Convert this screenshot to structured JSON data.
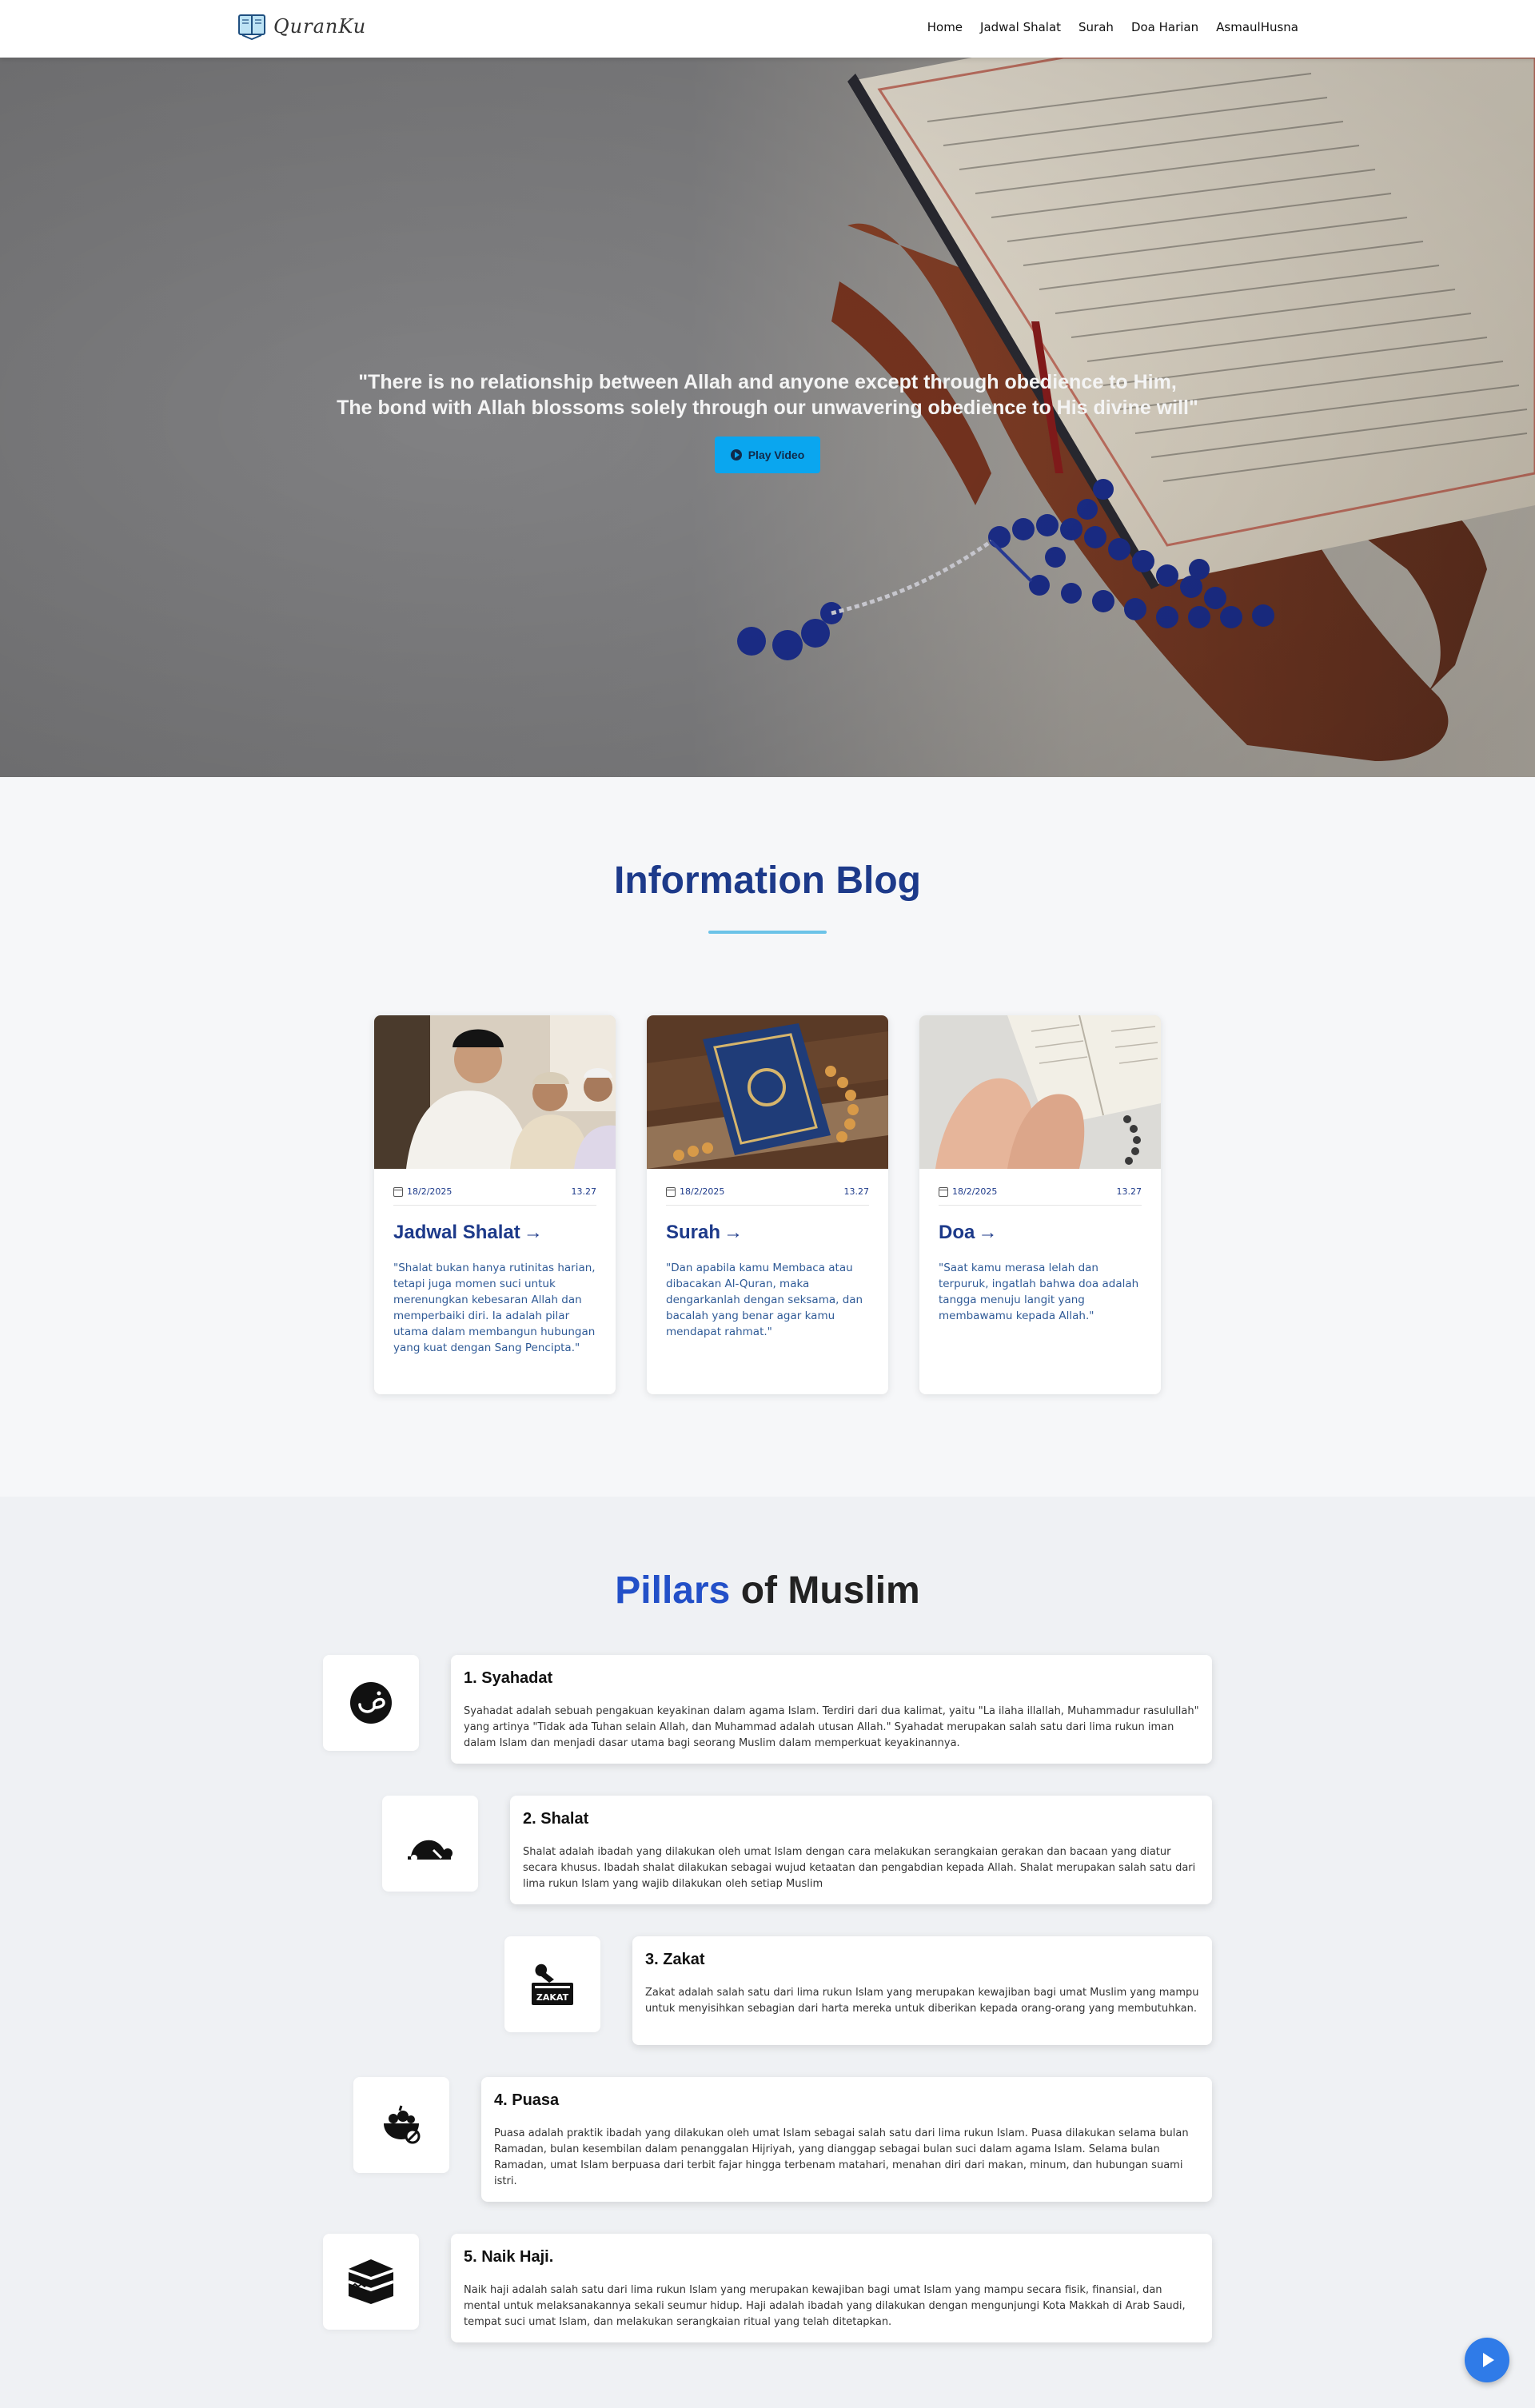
{
  "brand": {
    "name": "QuranKu"
  },
  "nav": {
    "items": [
      "Home",
      "Jadwal Shalat",
      "Surah",
      "Doa Harian",
      "AsmaulHusna"
    ]
  },
  "hero": {
    "quote_line1": "\"There is no relationship between Allah and anyone except through obedience to Him,",
    "quote_line2": "The bond with Allah blossoms solely through our unwavering obedience to His divine will\"",
    "play_label": "Play Video"
  },
  "blog": {
    "title": "Information Blog",
    "cards": [
      {
        "date": "18/2/2025",
        "time": "13.27",
        "title": "Jadwal Shalat",
        "arrow": "→",
        "text": "\"Shalat bukan hanya rutinitas harian, tetapi juga momen suci untuk merenungkan kebesaran Allah dan memperbaiki diri. Ia adalah pilar utama dalam membangun hubungan yang kuat dengan Sang Pencipta.\""
      },
      {
        "date": "18/2/2025",
        "time": "13.27",
        "title": "Surah",
        "arrow": "→",
        "text": "\"Dan apabila kamu Membaca atau dibacakan Al-Quran, maka dengarkanlah dengan seksama, dan bacalah yang benar agar kamu mendapat rahmat.\""
      },
      {
        "date": "18/2/2025",
        "time": "13.27",
        "title": "Doa",
        "arrow": "→",
        "text": "\"Saat kamu merasa lelah dan terpuruk, ingatlah bahwa doa adalah tangga menuju langit yang membawamu kepada Allah.\""
      }
    ]
  },
  "pillars": {
    "title_accent": "Pillars",
    "title_rest": " of Muslim",
    "items": [
      {
        "title": "1. Syahadat",
        "icon": "arabic-letter-icon",
        "text": "Syahadat adalah sebuah pengakuan keyakinan dalam agama Islam. Terdiri dari dua kalimat, yaitu \"La ilaha illallah, Muhammadur rasulullah\" yang artinya \"Tidak ada Tuhan selain Allah, dan Muhammad adalah utusan Allah.\" Syahadat merupakan salah satu dari lima rukun iman dalam Islam dan menjadi dasar utama bagi seorang Muslim dalam memperkuat keyakinannya."
      },
      {
        "title": "2. Shalat",
        "icon": "prayer-icon",
        "text": "Shalat adalah ibadah yang dilakukan oleh umat Islam dengan cara melakukan serangkaian gerakan dan bacaan yang diatur secara khusus. Ibadah shalat dilakukan sebagai wujud ketaatan dan pengabdian kepada Allah. Shalat merupakan salah satu dari lima rukun Islam yang wajib dilakukan oleh setiap Muslim"
      },
      {
        "title": "3. Zakat",
        "icon": "zakat-box-icon",
        "icon_label": "ZAKAT",
        "text": "Zakat adalah salah satu dari lima rukun Islam yang merupakan kewajiban bagi umat Muslim yang mampu untuk menyisihkan sebagian dari harta mereka untuk diberikan kepada orang-orang yang membutuhkan."
      },
      {
        "title": "4. Puasa",
        "icon": "fasting-bowl-icon",
        "text": "Puasa adalah praktik ibadah yang dilakukan oleh umat Islam sebagai salah satu dari lima rukun Islam. Puasa dilakukan selama bulan Ramadan, bulan kesembilan dalam penanggalan Hijriyah, yang dianggap sebagai bulan suci dalam agama Islam. Selama bulan Ramadan, umat Islam berpuasa dari terbit fajar hingga terbenam matahari, menahan diri dari makan, minum, dan hubungan suami istri."
      },
      {
        "title": "5. Naik Haji.",
        "icon": "kaaba-icon",
        "text": "Naik haji adalah salah satu dari lima rukun Islam yang merupakan kewajiban bagi umat Islam yang mampu secara fisik, finansial, dan mental untuk melaksanakannya sekali seumur hidup. Haji adalah ibadah yang dilakukan dengan mengunjungi Kota Makkah di Arab Saudi, tempat suci umat Islam, dan melakukan serangkaian ritual yang telah ditetapkan."
      }
    ]
  },
  "colors": {
    "primary": "#1d3a8a",
    "accent": "#2350c8",
    "button": "#0aa6ef",
    "fab": "#2f7be8"
  }
}
